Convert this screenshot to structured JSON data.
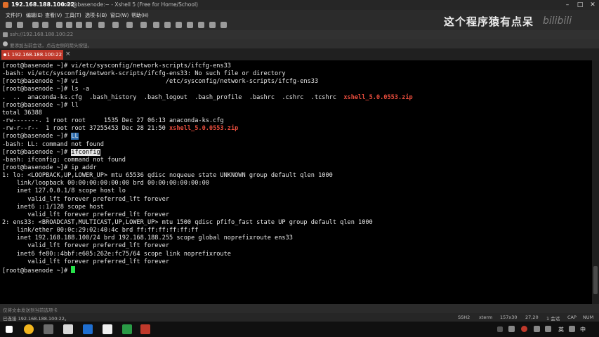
{
  "window": {
    "ip_title": "192.168.188.100:22",
    "subtitle": "root@basenode:~ - Xshell 5 (Free for Home/School)"
  },
  "menu": [
    "文件(F)",
    "编辑(E)",
    "查看(V)",
    "工具(T)",
    "选项卡(B)",
    "窗口(W)",
    "帮助(H)"
  ],
  "watermark": {
    "text": "这个程序猿有点呆",
    "logo": "bilibili"
  },
  "address": {
    "value": "ssh://192.168.188.100:22"
  },
  "hint": "要添加当前会话，点击左侧的箭头按钮。",
  "tab": {
    "label": "1 192.168.188.100:22",
    "close": "×"
  },
  "terminal": {
    "lines": [
      [
        {
          "t": "[root@basenode ~]# vi/etc/sysconfig/network-scripts/ifcfg-ens33"
        }
      ],
      [
        {
          "t": "-bash: vi/etc/sysconfig/network-scripts/ifcfg-ens33: No such file or directory"
        }
      ],
      [
        {
          "t": "[root@basenode ~]# vi                        /etc/sysconfig/network-scripts/ifcfg-ens33"
        }
      ],
      [
        {
          "t": "[root@basenode ~]# ls -a"
        }
      ],
      [
        {
          "t": ".  ..  anaconda-ks.cfg  .bash_history  .bash_logout  .bash_profile  .bashrc  .cshrc  .tcshrc  "
        },
        {
          "t": "xshell_5.0.0553.zip",
          "c": "red"
        }
      ],
      [
        {
          "t": "[root@basenode ~]# ll"
        }
      ],
      [
        {
          "t": "total 36388"
        }
      ],
      [
        {
          "t": "-rw-------. 1 root root     1535 Dec 27 06:13 anaconda-ks.cfg"
        }
      ],
      [
        {
          "t": "-rw-r--r--  1 root root 37255453 Dec 28 21:50 "
        },
        {
          "t": "xshell_5.0.0553.zip",
          "c": "red"
        }
      ],
      [
        {
          "t": "[root@basenode ~]# "
        },
        {
          "t": "LL",
          "c": "sel"
        }
      ],
      [
        {
          "t": "-bash: LL: command not found"
        }
      ],
      [
        {
          "t": "[root@basenode ~]# "
        },
        {
          "t": "ifconfig",
          "c": "hl"
        }
      ],
      [
        {
          "t": "-bash: ifconfig: command not found"
        }
      ],
      [
        {
          "t": "[root@basenode ~]# ip addr"
        }
      ],
      [
        {
          "t": "1: lo: <LOOPBACK,UP,LOWER_UP> mtu 65536 qdisc noqueue state UNKNOWN group default qlen 1000"
        }
      ],
      [
        {
          "t": "    link/loopback 00:00:00:00:00:00 brd 00:00:00:00:00:00"
        }
      ],
      [
        {
          "t": "    inet 127.0.0.1/8 scope host lo"
        }
      ],
      [
        {
          "t": "       valid_lft forever preferred_lft forever"
        }
      ],
      [
        {
          "t": "    inet6 ::1/128 scope host"
        }
      ],
      [
        {
          "t": "       valid_lft forever preferred_lft forever"
        }
      ],
      [
        {
          "t": "2: ens33: <BROADCAST,MULTICAST,UP,LOWER_UP> mtu 1500 qdisc pfifo_fast state UP group default qlen 1000"
        }
      ],
      [
        {
          "t": "    link/ether 00:0c:29:02:40:4c brd ff:ff:ff:ff:ff:ff"
        }
      ],
      [
        {
          "t": "    inet 192.168.188.100/24 brd 192.168.188.255 scope global noprefixroute ens33"
        }
      ],
      [
        {
          "t": "       valid_lft forever preferred_lft forever"
        }
      ],
      [
        {
          "t": "    inet6 fe80::4bbf:e605:262e:fc75/64 scope link noprefixroute"
        }
      ],
      [
        {
          "t": "       valid_lft forever preferred_lft forever"
        }
      ],
      [
        {
          "t": "[root@basenode ~]# "
        },
        {
          "cursor": true
        }
      ]
    ]
  },
  "sendbar": "仅将文本发送到当前选项卡",
  "status": {
    "connected": "已连接 192.168.188.100:22。",
    "protocol": "SSH2",
    "term": "xterm",
    "size": "157x30",
    "pos": "27,20",
    "sessions": "1 会话",
    "cap": "CAP",
    "num": "NUM"
  },
  "taskbar": {
    "ime": "英",
    "lang": "中"
  }
}
